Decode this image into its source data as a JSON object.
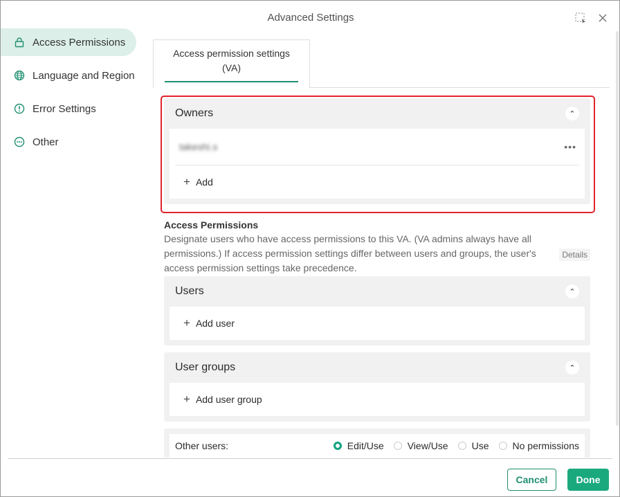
{
  "window": {
    "title": "Advanced Settings"
  },
  "sidebar": {
    "items": [
      {
        "label": "Access Permissions",
        "icon": "lock-icon",
        "active": true
      },
      {
        "label": "Language and Region",
        "icon": "globe-icon",
        "active": false
      },
      {
        "label": "Error Settings",
        "icon": "alert-circle-icon",
        "active": false
      },
      {
        "label": "Other",
        "icon": "other-icon",
        "active": false
      }
    ]
  },
  "tabs": [
    {
      "label": "Access permission settings (VA)"
    }
  ],
  "owners": {
    "title": "Owners",
    "owner_name": "takeshi.s",
    "more_label": "•••",
    "add_label": "Add"
  },
  "access_permissions": {
    "title": "Access Permissions",
    "description": "Designate users who have access permissions to this VA. (VA admins always have all permissions.) If access permission settings differ between users and groups, the user's access permission settings take precedence.",
    "details_label": "Details"
  },
  "users": {
    "title": "Users",
    "add_label": "Add user"
  },
  "user_groups": {
    "title": "User groups",
    "add_label": "Add user group"
  },
  "other_users": {
    "label": "Other users:",
    "options": [
      "Edit/Use",
      "View/Use",
      "Use",
      "No permissions"
    ],
    "selected": "Edit/Use"
  },
  "footer": {
    "cancel_label": "Cancel",
    "done_label": "Done"
  },
  "colors": {
    "accent": "#1aa97d",
    "highlight": "#e0222b",
    "sidebar_active": "#dcefe8"
  }
}
